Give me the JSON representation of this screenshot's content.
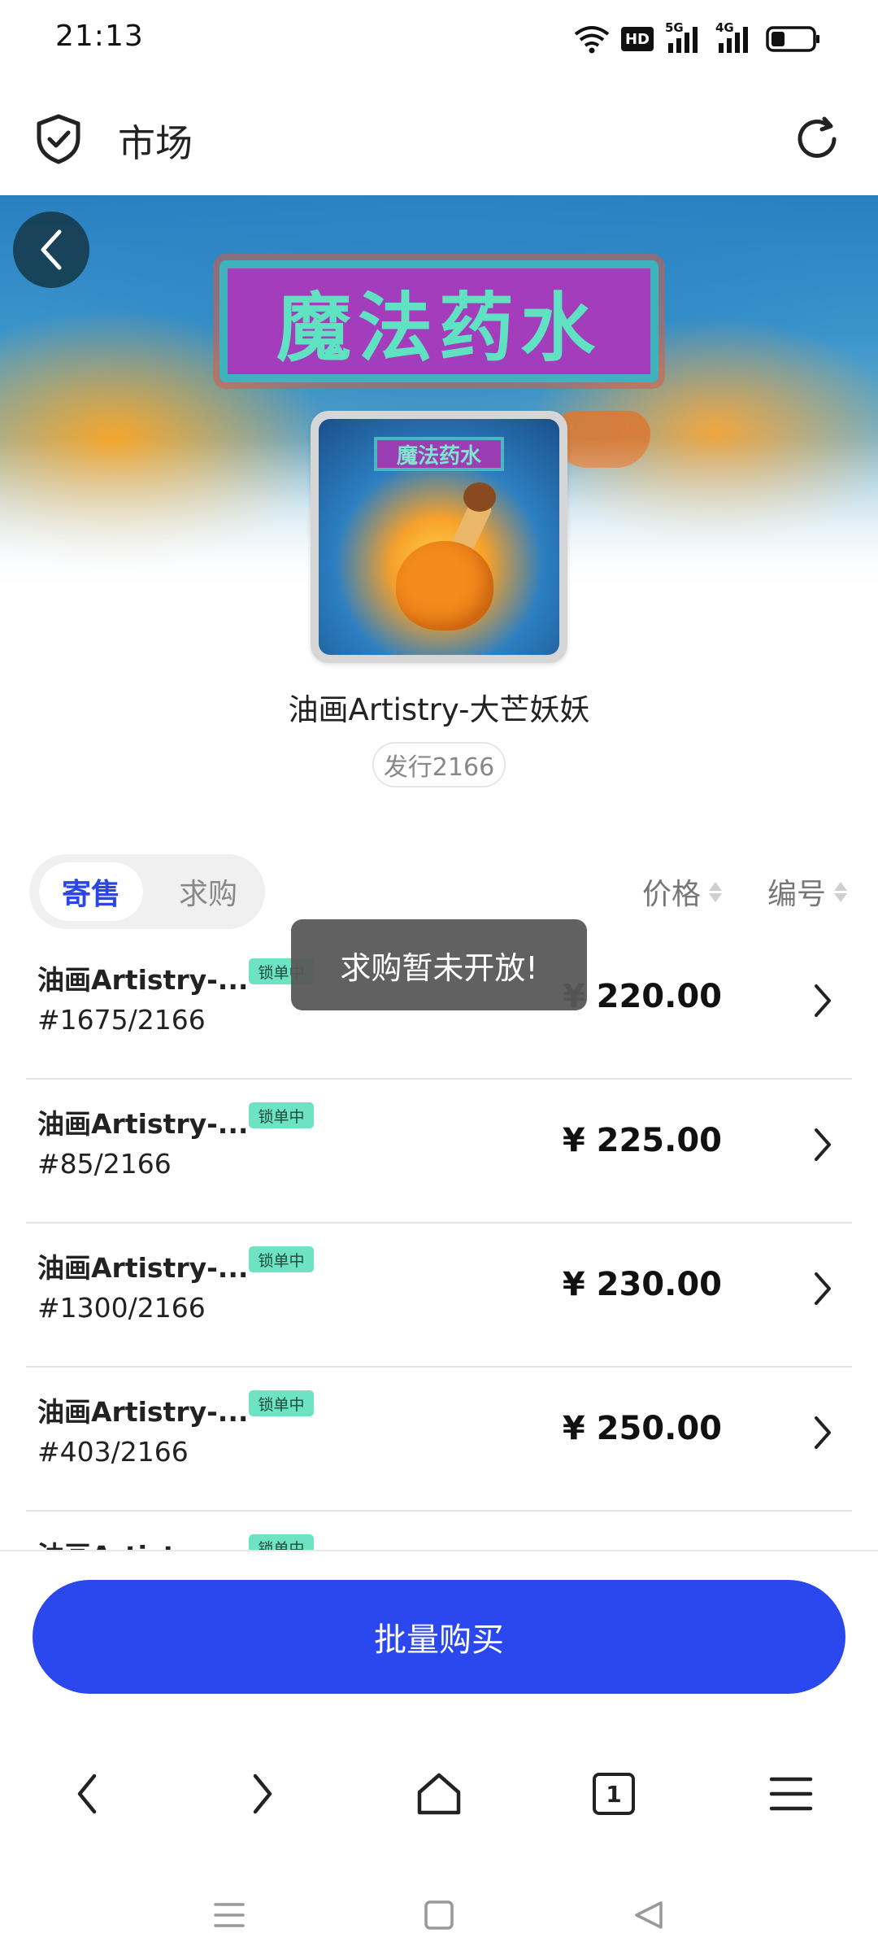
{
  "status_bar": {
    "time": "21:13",
    "icons": [
      "wifi-icon",
      "hd-icon",
      "signal-5g-icon",
      "signal-4g-icon",
      "battery-icon"
    ],
    "hd_label": "HD",
    "net1_label": "5G",
    "net2_label": "4G",
    "battery_level": 0.3
  },
  "header": {
    "title": "市场",
    "left_icon": "shield-check-icon",
    "right_icon": "refresh-icon"
  },
  "banner": {
    "sign_text": "魔法药水",
    "thumb_label": "魔法药水"
  },
  "item": {
    "title": "油画Artistry-大芒妖妖",
    "issue": "发行2166"
  },
  "tabs": [
    {
      "label": "寄售",
      "active": true
    },
    {
      "label": "求购",
      "active": false
    }
  ],
  "sorts": {
    "price_label": "价格",
    "number_label": "编号"
  },
  "listings": [
    {
      "title": "油画Artistry-...",
      "serial": "#1675/2166",
      "tag": "锁单中",
      "price": "¥ 220.00"
    },
    {
      "title": "油画Artistry-...",
      "serial": "#85/2166",
      "tag": "锁单中",
      "price": "¥ 225.00"
    },
    {
      "title": "油画Artistry-...",
      "serial": "#1300/2166",
      "tag": "锁单中",
      "price": "¥ 230.00"
    },
    {
      "title": "油画Artistry-...",
      "serial": "#403/2166",
      "tag": "锁单中",
      "price": "¥ 250.00"
    },
    {
      "title": "油画Artistry-...",
      "serial": "",
      "tag": "锁单中",
      "price": ""
    }
  ],
  "toast": {
    "message": "求购暂未开放!"
  },
  "bulk_buy": {
    "label": "批量购买"
  },
  "browser_bar": {
    "tab_count": "1",
    "icons": [
      "back-icon",
      "forward-icon",
      "home-icon",
      "tabs-icon",
      "menu-icon"
    ]
  },
  "system_nav": {
    "icons": [
      "recents-icon",
      "home-square-icon",
      "back-triangle-icon"
    ]
  },
  "colors": {
    "accent": "#2a48ee",
    "tag_green": "#6ee3c3",
    "toast_bg": "#585858"
  }
}
